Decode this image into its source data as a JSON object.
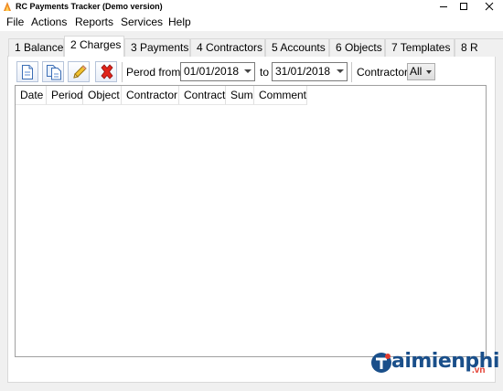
{
  "window": {
    "title": "RC Payments Tracker (Demo version)"
  },
  "menu": [
    "File",
    "Actions",
    "Reports",
    "Services",
    "Help"
  ],
  "tabs": [
    {
      "label": "1 Balance",
      "active": false
    },
    {
      "label": "2 Charges",
      "active": true
    },
    {
      "label": "3 Payments",
      "active": false
    },
    {
      "label": "4 Contractors",
      "active": false
    },
    {
      "label": "5 Accounts",
      "active": false
    },
    {
      "label": "6 Objects",
      "active": false
    },
    {
      "label": "7 Templates",
      "active": false
    },
    {
      "label": "8 R",
      "active": false
    }
  ],
  "toolbar": {
    "icons": [
      "new-document-icon",
      "copy-document-icon",
      "edit-pencil-icon",
      "delete-x-icon"
    ],
    "period_from_label": "Perod from",
    "date_from": "01/01/2018",
    "to_label": "to",
    "date_to": "31/01/2018",
    "contractor_label": "Contractor",
    "contractor_value": "All"
  },
  "grid": {
    "columns": [
      "Date",
      "Period",
      "Object",
      "Contractor",
      "Contract",
      "Sum",
      "Comment"
    ],
    "rows": []
  },
  "watermark": {
    "text": "aimienphi",
    "suffix": ".vn"
  },
  "colors": {
    "close_red": "#c42b1c",
    "watermark_blue": "#1a4f8a",
    "watermark_red": "#e23b2e"
  }
}
